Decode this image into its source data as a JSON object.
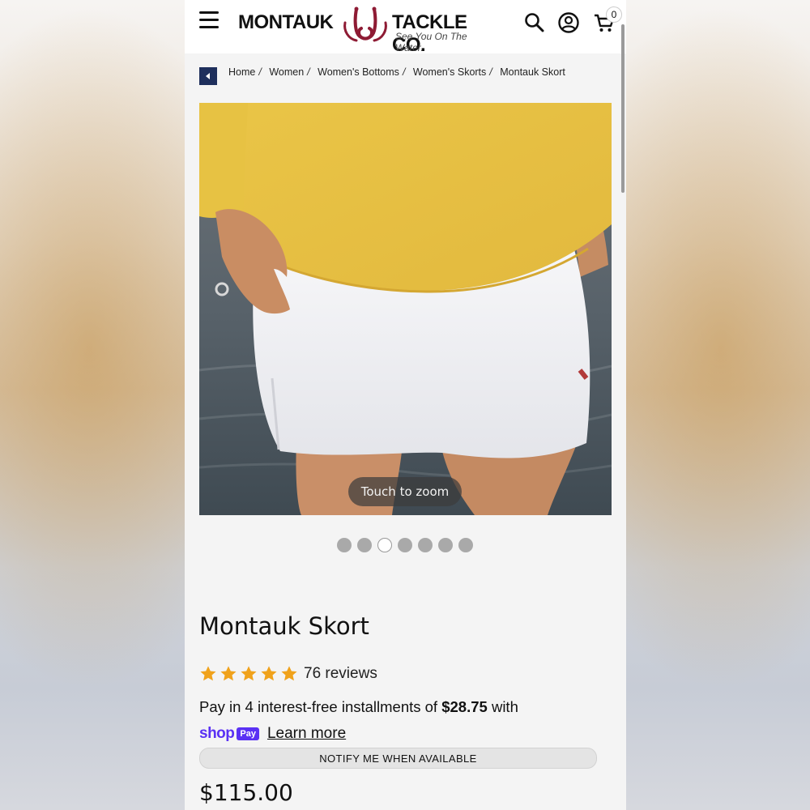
{
  "header": {
    "logo_left": "MONTAUK",
    "logo_right": "TACKLE CO.",
    "tagline": "See You On The Water.",
    "cart_count": "0"
  },
  "breadcrumb": [
    "Home",
    "Women",
    "Women's Bottoms",
    "Women's Skorts",
    "Montauk Skort"
  ],
  "gallery": {
    "zoom_hint": "Touch to zoom",
    "slide_count": 7,
    "active_slide": 3
  },
  "product": {
    "title": "Montauk Skort",
    "rating_stars": 5,
    "reviews": "76 reviews",
    "installments_prefix": "Pay in 4 interest-free installments of ",
    "installment_amount": "$28.75",
    "installments_suffix": " with",
    "shop_word": "shop",
    "pay_badge": "Pay",
    "learn_more": "Learn more",
    "notify_button": "NOTIFY ME WHEN AVAILABLE",
    "price": "$115.00"
  },
  "colors": {
    "shop_pay": "#5a31f4",
    "star": "#f0a21b",
    "back_button": "#1e2f5c",
    "logo_hooks": "#8e1b34"
  }
}
